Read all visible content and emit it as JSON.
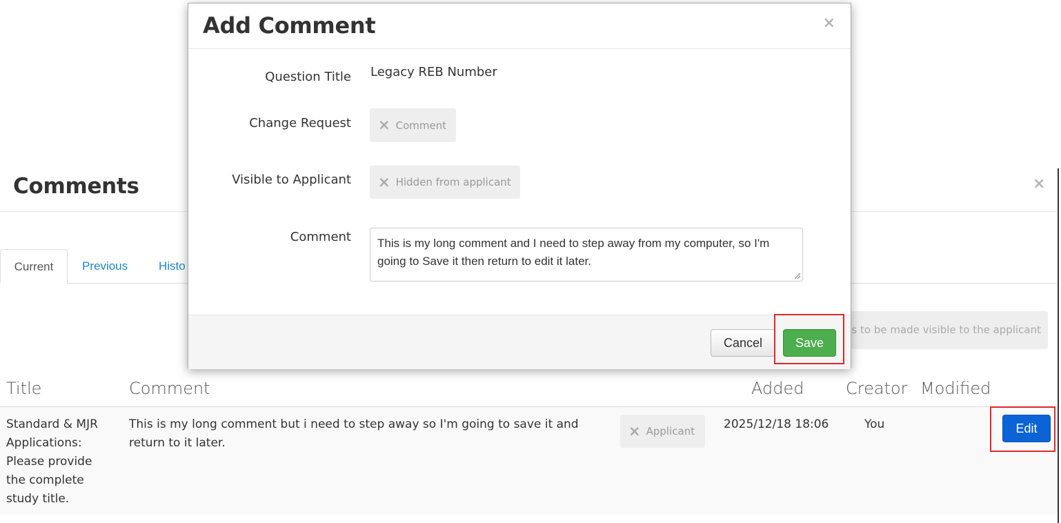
{
  "comments_panel": {
    "title": "Comments",
    "close_glyph": "×",
    "tabs": [
      {
        "label": "Current",
        "active": true
      },
      {
        "label": "Previous",
        "active": false
      },
      {
        "label": "Histo",
        "active": false
      }
    ],
    "visibility_note": "s to be made visible to the applicant",
    "table": {
      "columns": [
        "Title",
        "Comment",
        "Added",
        "Creator",
        "Modified"
      ],
      "rows": [
        {
          "title": "Standard & MJR Applications: Please provide the complete study title.",
          "comment": "This is my long comment but i need to step away so I'm going to save it and return to it later.",
          "visibility_chip": "Applicant",
          "added": "2025/12/18 18:06",
          "creator": "You",
          "modified": "",
          "edit_label": "Edit"
        }
      ]
    }
  },
  "modal": {
    "title": "Add Comment",
    "close_glyph": "×",
    "fields": {
      "question_title": {
        "label": "Question Title",
        "value": "Legacy REB Number"
      },
      "change_request": {
        "label": "Change Request",
        "chip": "Comment"
      },
      "visible_to_applicant": {
        "label": "Visible to Applicant",
        "chip": "Hidden from applicant"
      },
      "comment": {
        "label": "Comment",
        "value": "This is my long comment and I need to step away from my computer, so I'm going to Save it then return to edit it later."
      }
    },
    "cancel_label": "Cancel",
    "save_label": "Save"
  },
  "chip_icon": "×",
  "colors": {
    "primary": "#0c63d6",
    "success": "#4cae4c",
    "highlight": "#e02828",
    "link": "#1a86c8"
  }
}
